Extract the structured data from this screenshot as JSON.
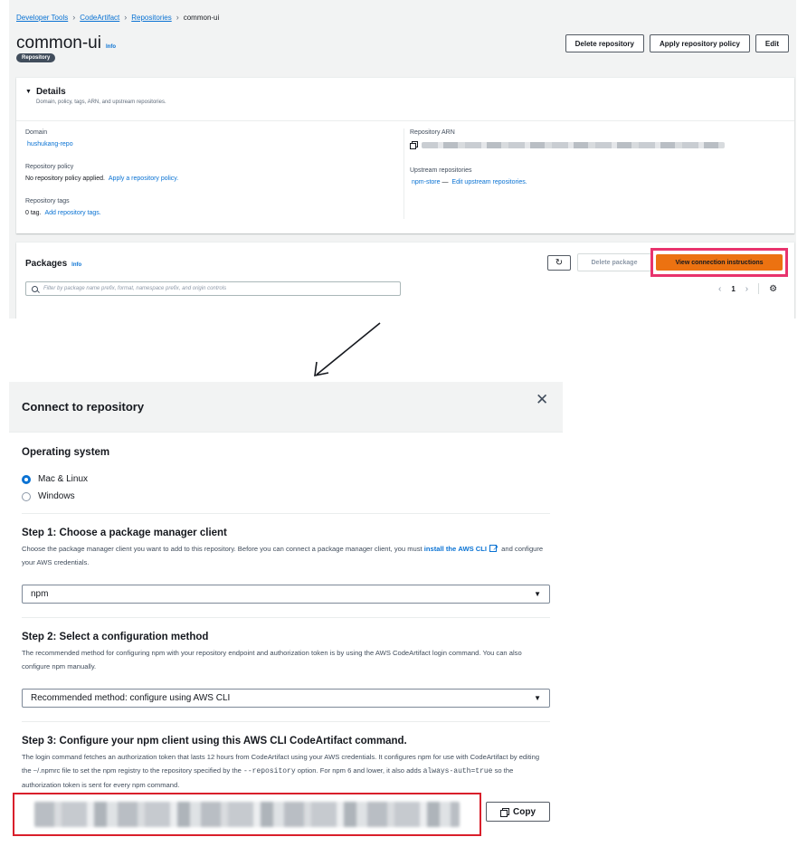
{
  "breadcrumb": {
    "items": [
      "Developer Tools",
      "CodeArtifact",
      "Repositories"
    ],
    "current": "common-ui"
  },
  "header": {
    "title": "common-ui",
    "info": "Info",
    "badge": "Repository",
    "delete_repo": "Delete repository",
    "apply_policy": "Apply repository policy",
    "edit": "Edit"
  },
  "details": {
    "title": "Details",
    "description": "Domain, policy, tags, ARN, and upstream repositories.",
    "domain_label": "Domain",
    "domain_value": "hushukang-repo",
    "policy_label": "Repository policy",
    "policy_value": "No repository policy applied.",
    "policy_link": "Apply a repository policy.",
    "tags_label": "Repository tags",
    "tags_value": "0 tag.",
    "tags_link": "Add repository tags.",
    "arn_label": "Repository ARN",
    "upstream_label": "Upstream repositories",
    "upstream_value": "npm-store",
    "upstream_sep": "—",
    "upstream_link": "Edit upstream repositories."
  },
  "packages": {
    "title": "Packages",
    "info": "Info",
    "delete": "Delete package",
    "view_connection": "View connection instructions",
    "filter_placeholder": "Filter by package name prefix, format, namespace prefix, and origin controls",
    "page": "1"
  },
  "modal": {
    "title": "Connect to repository",
    "os_title": "Operating system",
    "os_options": [
      "Mac & Linux",
      "Windows"
    ],
    "os_selected": "Mac & Linux",
    "step1_title": "Step 1: Choose a package manager client",
    "step1_desc_a": "Choose the package manager client you want to add to this repository. Before you can connect a package manager client, you must",
    "step1_link_a": "install the",
    "step1_link_b": "AWS CLI",
    "step1_desc_b": "and configure your AWS credentials.",
    "step1_value": "npm",
    "step2_title": "Step 2: Select a configuration method",
    "step2_desc": "The recommended method for configuring npm with your repository endpoint and authorization token is by using the AWS CodeArtifact login command. You can also configure npm manually.",
    "step2_value": "Recommended method: configure using AWS CLI",
    "step3_title": "Step 3: Configure your npm client using this AWS CLI CodeArtifact command.",
    "step3_desc_a": "The login command fetches an authorization token that lasts 12 hours from CodeArtifact using your AWS credentials. It configures npm for use with CodeArtifact by editing the ~/.npmrc file to set the npm registry to the repository specified by the",
    "step3_code_a": "--repository",
    "step3_desc_b": "option. For npm 6 and lower, it also adds",
    "step3_code_b": "always-auth=true",
    "step3_desc_c": "so the authorization token is sent for every npm command.",
    "copy": "Copy"
  },
  "colors": {
    "link": "#0972d3",
    "primary_button": "#ec7211",
    "highlight_pink": "#e8336d",
    "highlight_red": "#d91f2b",
    "badge": "#414d5c"
  },
  "icons": [
    "chevron-right-icon",
    "caret-down-icon",
    "copy-icon",
    "refresh-icon",
    "search-icon",
    "settings-gear-icon",
    "close-icon",
    "external-link-icon",
    "arrow-annotation-icon"
  ]
}
